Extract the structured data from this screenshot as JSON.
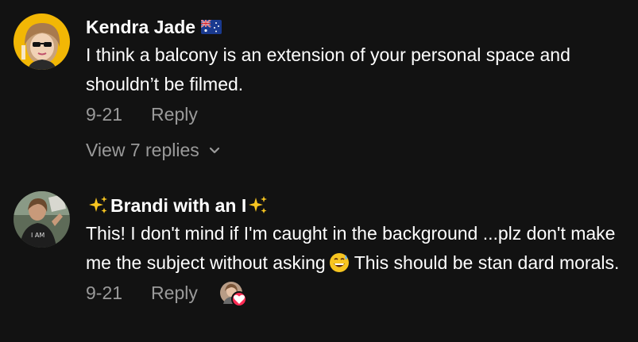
{
  "comments": [
    {
      "username": "Kendra Jade",
      "text": "I think a balcony is an extension of your personal space and shouldn’t be filmed.",
      "date": "9-21",
      "reply_label": "Reply",
      "view_replies_label": "View 7 replies",
      "flag_icon": "australia-flag-icon"
    },
    {
      "username_prefix_icon": "sparkles-icon",
      "username": "Brandi with an I",
      "username_suffix_icon": "sparkles-icon",
      "text_part1": "This! I don't mind if I'm caught in the background ...plz don't make me the subject without asking",
      "emoji_icon": "grinning-sweat-emoji-icon",
      "text_part2": "This should be stan dard morals.",
      "date": "9-21",
      "reply_label": "Reply",
      "liked_by_creator_icon": "heart-icon"
    }
  ],
  "colors": {
    "background": "#121212",
    "primary_text": "#ffffff",
    "secondary_text": "#9a9a9a",
    "heart": "#fe2c55"
  }
}
